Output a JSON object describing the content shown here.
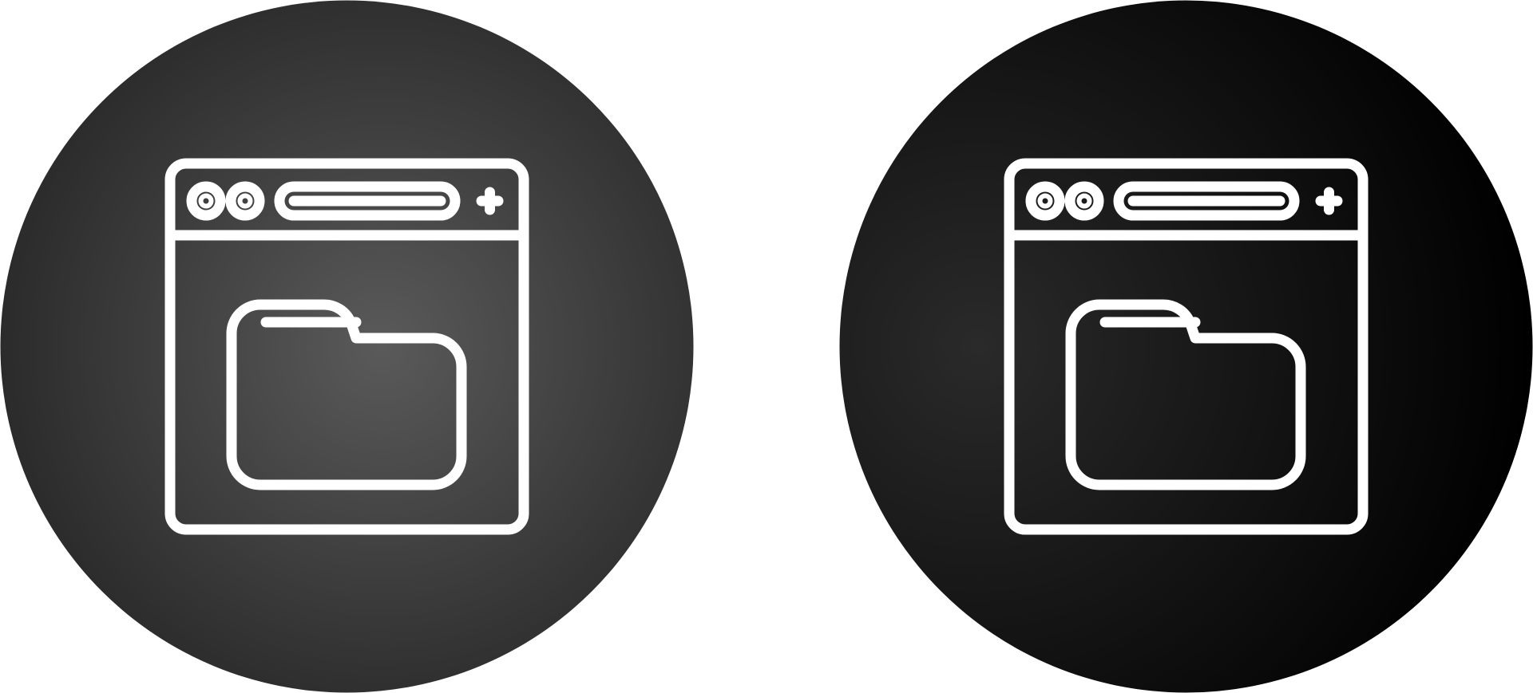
{
  "icons": [
    {
      "id": "badge-left",
      "name": "browser-folder-icon",
      "variant": "gradient-gray",
      "colors": {
        "center": "#5a5a5a",
        "edge": "#2b2b2b",
        "stroke": "#ffffff"
      }
    },
    {
      "id": "badge-right",
      "name": "browser-folder-icon",
      "variant": "gradient-black",
      "colors": {
        "center": "#2a2a2a",
        "edge": "#000000",
        "stroke": "#ffffff"
      }
    }
  ]
}
